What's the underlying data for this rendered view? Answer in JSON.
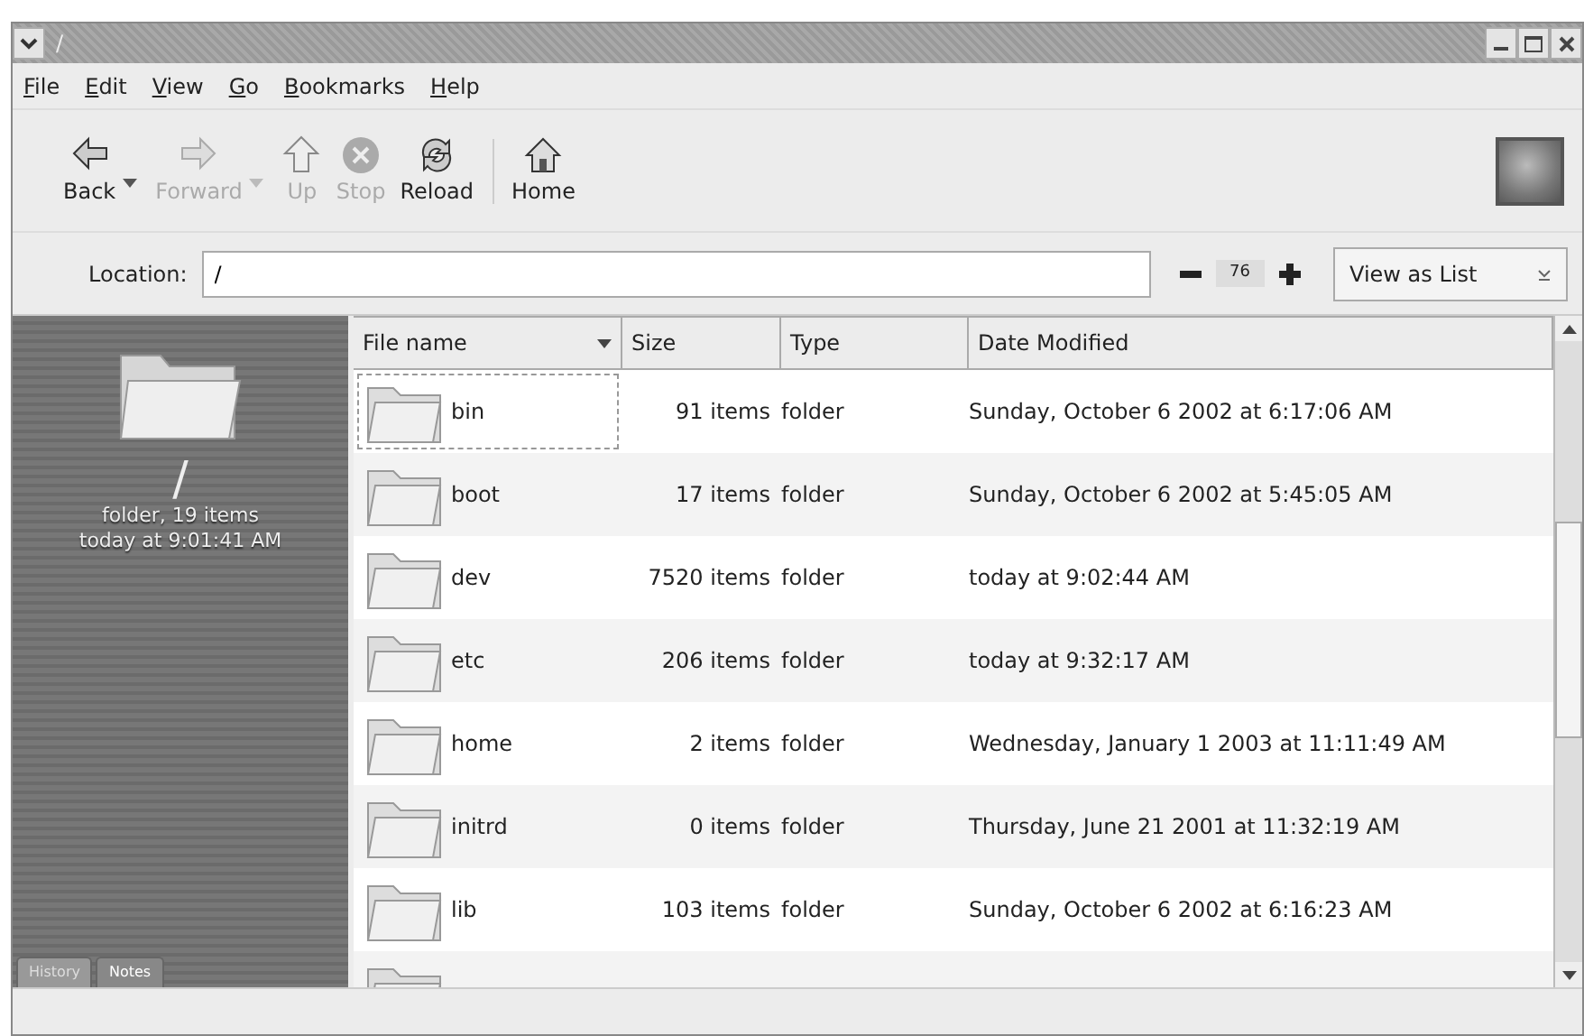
{
  "window": {
    "title": "/"
  },
  "menu": [
    "File",
    "Edit",
    "View",
    "Go",
    "Bookmarks",
    "Help"
  ],
  "toolbar": [
    {
      "label": "Back",
      "kind": "back",
      "disabled": false,
      "has_menu": true
    },
    {
      "label": "Forward",
      "kind": "forward",
      "disabled": true,
      "has_menu": true
    },
    {
      "label": "Up",
      "kind": "up",
      "disabled": true,
      "has_menu": false
    },
    {
      "label": "Stop",
      "kind": "stop",
      "disabled": true,
      "has_menu": false
    },
    {
      "label": "Reload",
      "kind": "reload",
      "disabled": false,
      "has_menu": false
    },
    {
      "label": "Home",
      "kind": "home",
      "disabled": false,
      "has_menu": false
    }
  ],
  "location": {
    "label": "Location:",
    "value": "/"
  },
  "zoom": {
    "value": "76"
  },
  "view_mode": "View as List",
  "sidebar": {
    "name": "/",
    "info": "folder, 19 items",
    "date": "today at 9:01:41 AM",
    "tabs": [
      {
        "label": "History",
        "selected": false
      },
      {
        "label": "Notes",
        "selected": true
      }
    ]
  },
  "table": {
    "columns": [
      "File name",
      "Size",
      "Type",
      "Date Modified"
    ],
    "rows": [
      {
        "name": "bin",
        "size": "91 items",
        "type": "folder",
        "date": "Sunday, October 6 2002 at 6:17:06 AM",
        "selected": true
      },
      {
        "name": "boot",
        "size": "17 items",
        "type": "folder",
        "date": "Sunday, October 6 2002 at 5:45:05 AM",
        "selected": false
      },
      {
        "name": "dev",
        "size": "7520 items",
        "type": "folder",
        "date": "today at 9:02:44 AM",
        "selected": false
      },
      {
        "name": "etc",
        "size": "206 items",
        "type": "folder",
        "date": "today at 9:32:17 AM",
        "selected": false
      },
      {
        "name": "home",
        "size": "2 items",
        "type": "folder",
        "date": "Wednesday, January 1 2003 at 11:11:49 AM",
        "selected": false
      },
      {
        "name": "initrd",
        "size": "0 items",
        "type": "folder",
        "date": "Thursday, June 21 2001 at 11:32:19 AM",
        "selected": false
      },
      {
        "name": "lib",
        "size": "103 items",
        "type": "folder",
        "date": "Sunday, October 6 2002 at 6:16:23 AM",
        "selected": false
      }
    ]
  }
}
